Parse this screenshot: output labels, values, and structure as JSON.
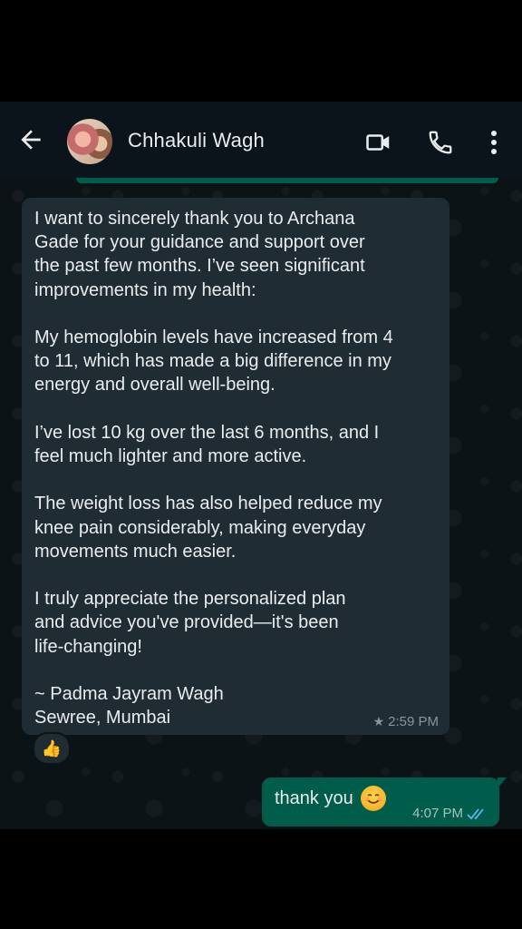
{
  "header": {
    "contact_name": "Chhakuli Wagh",
    "icons": {
      "back": "arrow-left-icon",
      "video": "video-call-icon",
      "call": "phone-icon",
      "more": "more-vertical-icon"
    }
  },
  "messages": [
    {
      "direction": "incoming",
      "text": "I want to sincerely thank you to Archana\nGade for your guidance and support over\nthe past few months. I’ve seen significant\nimprovements in my health:\n\nMy hemoglobin levels have increased from 4\nto 11, which has made a big difference in my\nenergy and overall well-being.\n\nI’ve lost 10 kg over the last 6 months, and I\nfeel much lighter and more active.\n\nThe weight loss has also helped reduce my\nknee pain considerably, making everyday\nmovements much easier.\n\nI truly appreciate the personalized plan\nand advice you've provided—it's been\nlife-changing!\n\n~ Padma Jayram Wagh\nSewree, Mumbai",
      "time": "2:59 PM",
      "starred": true,
      "reaction": "👍"
    },
    {
      "direction": "outgoing",
      "text": "thank you",
      "emoji": "smiling-face-icon",
      "time": "4:07 PM",
      "status": "read"
    }
  ],
  "colors": {
    "header_bg": "#0b141a",
    "incoming_bubble": "#202c33",
    "outgoing_bubble": "#005c4b",
    "read_ticks": "#53bdeb"
  }
}
